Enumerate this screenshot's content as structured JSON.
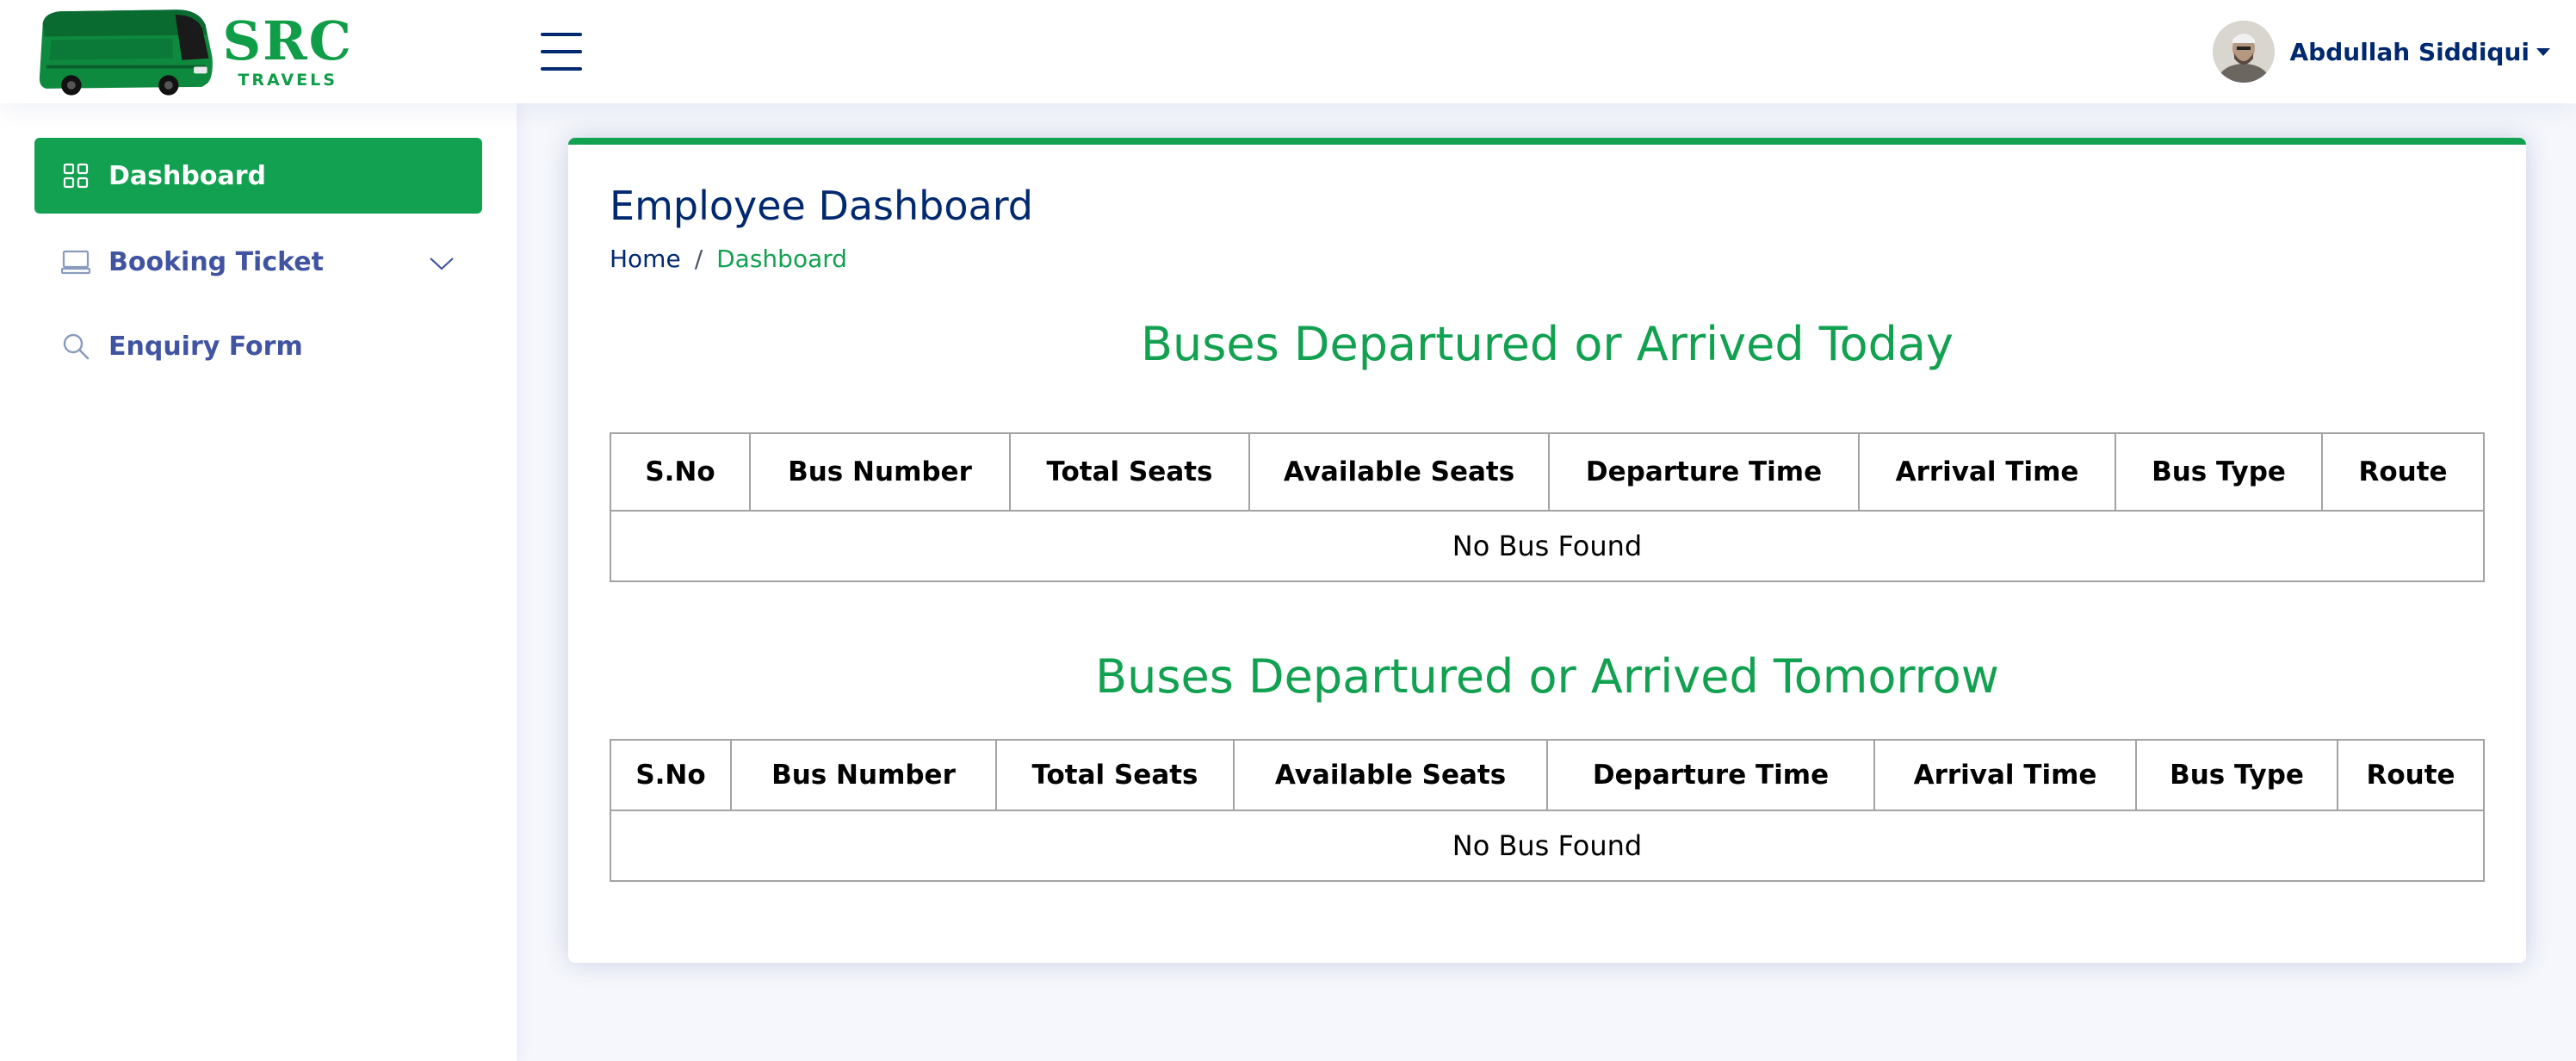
{
  "header": {
    "brand": {
      "name": "SRC",
      "subtitle": "TRAVELS"
    },
    "user": {
      "name": "Abdullah Siddiqui"
    }
  },
  "sidebar": {
    "items": [
      {
        "label": "Dashboard",
        "icon": "grid-icon",
        "active": true
      },
      {
        "label": "Booking Ticket",
        "icon": "laptop-icon",
        "has_submenu": true
      },
      {
        "label": "Enquiry Form",
        "icon": "search-icon"
      }
    ]
  },
  "main": {
    "title": "Employee Dashboard",
    "breadcrumb": {
      "home": "Home",
      "separator": "/",
      "current": "Dashboard"
    },
    "sections": [
      {
        "title": "Buses Departured or Arrived Today",
        "columns": [
          "S.No",
          "Bus Number",
          "Total Seats",
          "Available Seats",
          "Departure Time",
          "Arrival Time",
          "Bus Type",
          "Route"
        ],
        "empty_message": "No Bus Found"
      },
      {
        "title": "Buses Departured or Arrived Tomorrow",
        "columns": [
          "S.No",
          "Bus Number",
          "Total Seats",
          "Available Seats",
          "Departure Time",
          "Arrival Time",
          "Bus Type",
          "Route"
        ],
        "empty_message": "No Bus Found"
      }
    ]
  },
  "colors": {
    "accent": "#12a150",
    "text_dark": "#012970",
    "background": "#f5f7fc"
  }
}
